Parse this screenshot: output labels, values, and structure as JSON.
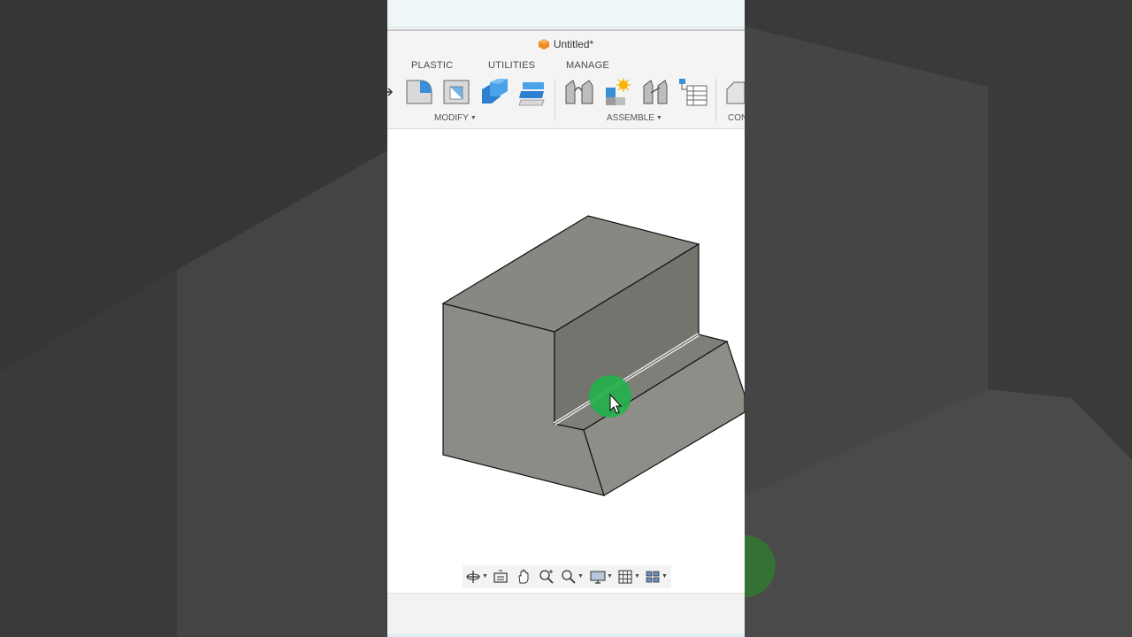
{
  "document": {
    "title": "Untitled*"
  },
  "ribbon": {
    "tabs": [
      "PLASTIC",
      "UTILITIES",
      "MANAGE"
    ],
    "groups": {
      "modify": "MODIFY",
      "assemble": "ASSEMBLE",
      "construct_partial": "CON"
    }
  },
  "colors": {
    "selection_highlight": "#22b14c",
    "model_face": "#8a8a84",
    "accent_blue": "#3b8fd6"
  },
  "navbar": {
    "icons": [
      "orbit-icon",
      "look-at-icon",
      "pan-icon",
      "zoom-icon",
      "fit-icon",
      "display-settings-icon",
      "grid-icon",
      "viewports-icon"
    ]
  }
}
